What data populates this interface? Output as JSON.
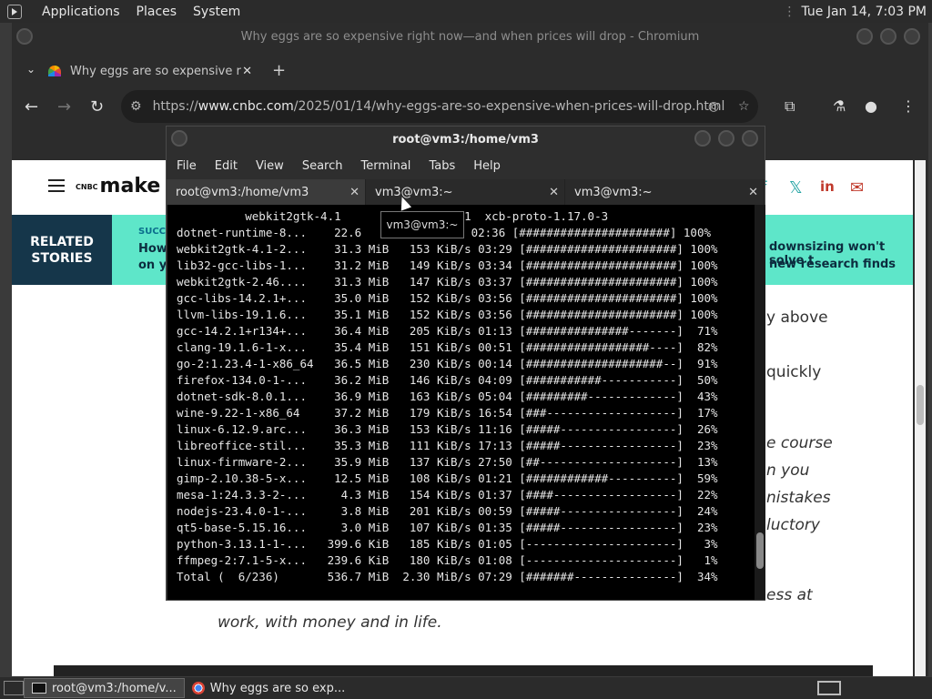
{
  "topbar": {
    "menus": [
      "Applications",
      "Places",
      "System"
    ],
    "datetime": "Tue Jan 14,  7:03 PM"
  },
  "chromium": {
    "window_title": "Why eggs are so expensive right now—and when prices will drop - Chromium",
    "tab_title": "Why eggs are so expensive r",
    "url_prefix": "https://",
    "url_host": "www.cnbc.com",
    "url_path": "/2025/01/14/why-eggs-are-so-expensive-when-prices-will-drop.html"
  },
  "page": {
    "logo_small": "CNBC",
    "logo": "make it",
    "related_label": "RELATED STORIES",
    "related_left_top": "SUCC",
    "related_left_1": "How",
    "related_left_2": "on y",
    "related_right_1": "downsizing won't solve t",
    "related_right_2": "new research finds",
    "snippets": [
      "y above",
      "quickly",
      "e course",
      "n you",
      "nistakes",
      "luctory",
      "ess at",
      "work, with money and in life."
    ]
  },
  "terminal": {
    "title": "root@vm3:/home/vm3",
    "menu": [
      "File",
      "Edit",
      "View",
      "Search",
      "Terminal",
      "Tabs",
      "Help"
    ],
    "tabs": [
      {
        "label": "root@vm3:/home/vm3",
        "close": "✕"
      },
      {
        "label": "vm3@vm3:~",
        "close": "✕"
      },
      {
        "label": "vm3@vm3:~",
        "close": "✕"
      }
    ],
    "tooltip": "vm3@vm3:~",
    "lines": [
      "          webkit2gtk-4.1         ine-9.22-1  xcb-proto-1.17.0-3",
      "dotnet-runtime-8...    22.6            B/s 02:36 [######################] 100%",
      "webkit2gtk-4.1-2...    31.3 MiB   153 KiB/s 03:29 [######################] 100%",
      "lib32-gcc-libs-1...    31.2 MiB   149 KiB/s 03:34 [######################] 100%",
      "webkit2gtk-2.46....    31.3 MiB   147 KiB/s 03:37 [######################] 100%",
      "gcc-libs-14.2.1+...    35.0 MiB   152 KiB/s 03:56 [######################] 100%",
      "llvm-libs-19.1.6...    35.1 MiB   152 KiB/s 03:56 [######################] 100%",
      "gcc-14.2.1+r134+...    36.4 MiB   205 KiB/s 01:13 [###############-------]  71%",
      "clang-19.1.6-1-x...    35.4 MiB   151 KiB/s 00:51 [##################----]  82%",
      "go-2:1.23.4-1-x86_64   36.5 MiB   230 KiB/s 00:14 [####################--]  91%",
      "firefox-134.0-1-...    36.2 MiB   146 KiB/s 04:09 [###########-----------]  50%",
      "dotnet-sdk-8.0.1...    36.9 MiB   163 KiB/s 05:04 [#########-------------]  43%",
      "wine-9.22-1-x86_64     37.2 MiB   179 KiB/s 16:54 [###-------------------]  17%",
      "linux-6.12.9.arc...    36.3 MiB   153 KiB/s 11:16 [#####-----------------]  26%",
      "libreoffice-stil...    35.3 MiB   111 KiB/s 17:13 [#####-----------------]  23%",
      "linux-firmware-2...    35.9 MiB   137 KiB/s 27:50 [##--------------------]  13%",
      "gimp-2.10.38-5-x...    12.5 MiB   108 KiB/s 01:21 [############----------]  59%",
      "mesa-1:24.3.3-2-...     4.3 MiB   154 KiB/s 01:37 [####------------------]  22%",
      "nodejs-23.4.0-1-...     3.8 MiB   201 KiB/s 00:59 [#####-----------------]  24%",
      "qt5-base-5.15.16...     3.0 MiB   107 KiB/s 01:35 [#####-----------------]  23%",
      "python-3.13.1-1-...   399.6 KiB   185 KiB/s 01:05 [----------------------]   3%",
      "ffmpeg-2:7.1-5-x...   239.6 KiB   180 KiB/s 01:08 [----------------------]   1%",
      "Total (  6/236)       536.7 MiB  2.30 MiB/s 07:29 [#######---------------]  34%"
    ]
  },
  "taskbar": {
    "items": [
      {
        "label": "root@vm3:/home/v...",
        "icon": "terminal-icon"
      },
      {
        "label": "Why eggs are so exp...",
        "icon": "chromium-icon"
      }
    ]
  }
}
